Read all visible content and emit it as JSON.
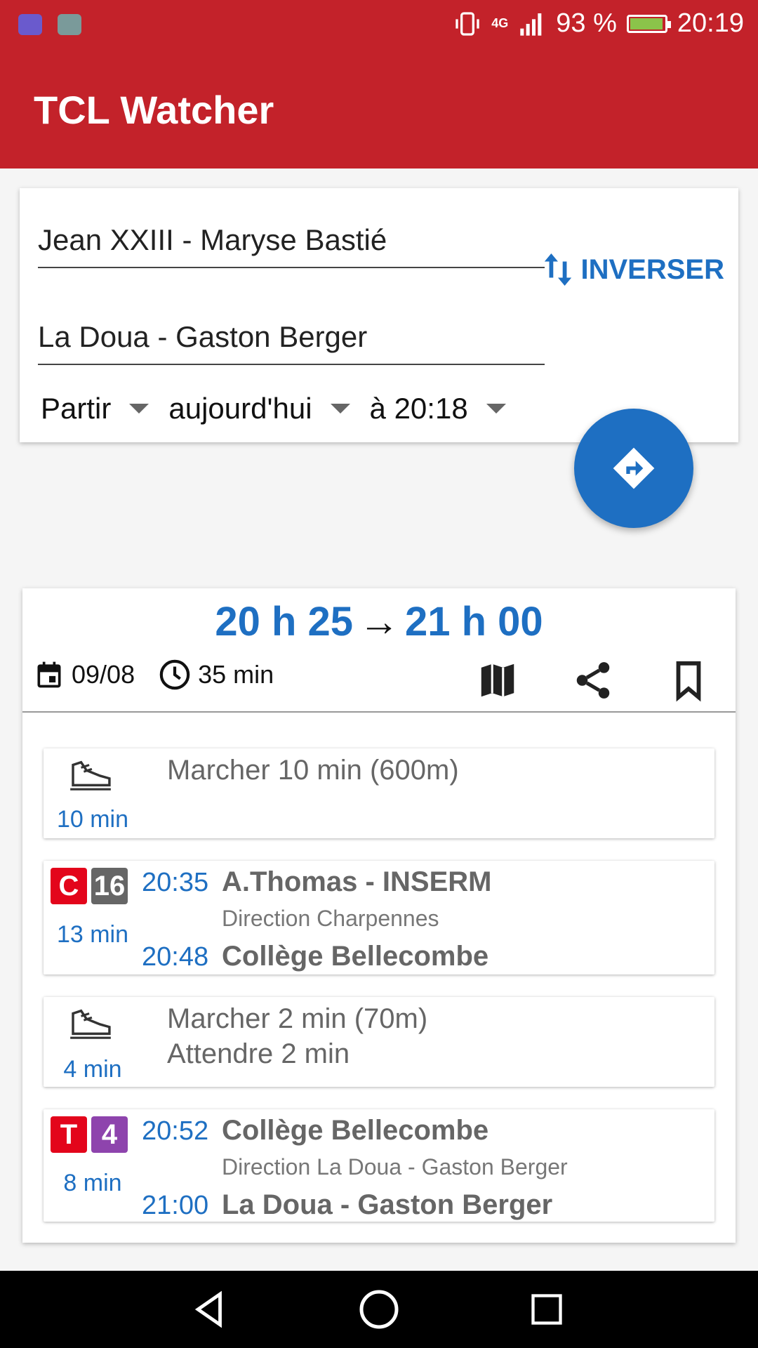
{
  "status_bar": {
    "network": "4G",
    "battery": "93 %",
    "time": "20:19"
  },
  "app": {
    "title": "TCL Watcher"
  },
  "search": {
    "from": "Jean XXIII - Maryse Bastié",
    "to": "La Doua - Gaston Berger",
    "swap_label": "INVERSER",
    "mode": "Partir",
    "day": "aujourd'hui",
    "time": "à 20:18"
  },
  "result": {
    "depart": "20 h 25",
    "arrow": "→",
    "arrive": "21 h 00",
    "date": "09/08",
    "duration": "35 min",
    "legs": [
      {
        "type": "walk",
        "text": "Marcher 10 min (600m)",
        "duration": "10 min"
      },
      {
        "type": "transit",
        "mode_letter": "C",
        "mode_color": "#e3051b",
        "line": "16",
        "line_color": "#666666",
        "duration": "13 min",
        "dep_time": "20:35",
        "dep_stop": "A.Thomas - INSERM",
        "direction": "Direction Charpennes",
        "arr_time": "20:48",
        "arr_stop": "Collège Bellecombe"
      },
      {
        "type": "walk",
        "text": "Marcher 2 min (70m)",
        "text2": "Attendre 2 min",
        "duration": "4 min"
      },
      {
        "type": "transit",
        "mode_letter": "T",
        "mode_color": "#e3051b",
        "line": "4",
        "line_color": "#8e44ad",
        "duration": "8 min",
        "dep_time": "20:52",
        "dep_stop": "Collège Bellecombe",
        "direction": "Direction La Doua - Gaston Berger",
        "arr_time": "21:00",
        "arr_stop": "La Doua - Gaston Berger"
      }
    ]
  },
  "colors": {
    "brand": "#c3222a",
    "accent": "#1e6fc2"
  },
  "icons": [
    "usb-icon",
    "gallery-icon",
    "vibrate-icon",
    "signal-icon",
    "battery-icon",
    "swap-icon",
    "directions-icon",
    "calendar-icon",
    "clock-icon",
    "map-icon",
    "share-icon",
    "bookmark-icon",
    "walk-shoe-icon",
    "back-icon",
    "home-icon",
    "recents-icon"
  ]
}
